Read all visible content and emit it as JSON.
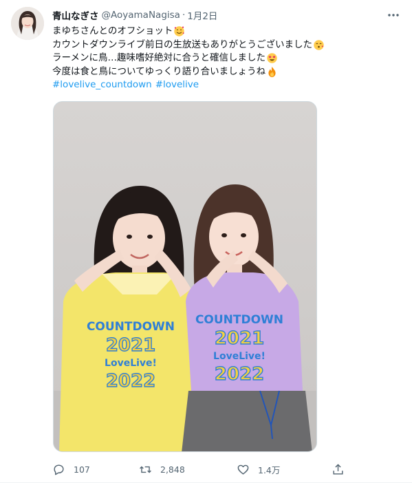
{
  "tweet": {
    "display_name": "青山なぎさ",
    "handle": "@AoyamaNagisa",
    "separator": "·",
    "date": "1月2日",
    "lines": [
      "まゆちさんとのオフショット",
      "カウントダウンライブ前日の生放送もありがとうございました",
      "ラーメンに鳥…趣味嗜好絶対に合うと確信しました",
      "今度は食と鳥についてゆっくり語り合いましょうね"
    ],
    "line_emojis": [
      "smiling-face-with-hearts",
      "kissing-face",
      "star-struck-face",
      "fire"
    ],
    "hashtags": [
      "#lovelive_countdown",
      "#lovelive"
    ],
    "image": {
      "shirt_left": [
        "COUNTDOWN",
        "2021",
        "LoveLive!",
        "2022"
      ],
      "shirt_right": [
        "COUNTDOWN",
        "2021",
        "LoveLive!",
        "2022"
      ]
    }
  },
  "actions": {
    "reply_count": "107",
    "retweet_count": "2,848",
    "like_count": "1.4万"
  },
  "colors": {
    "text": "#0f1419",
    "secondary": "#536471",
    "link": "#1d9bf0",
    "border": "#cfd9de"
  }
}
